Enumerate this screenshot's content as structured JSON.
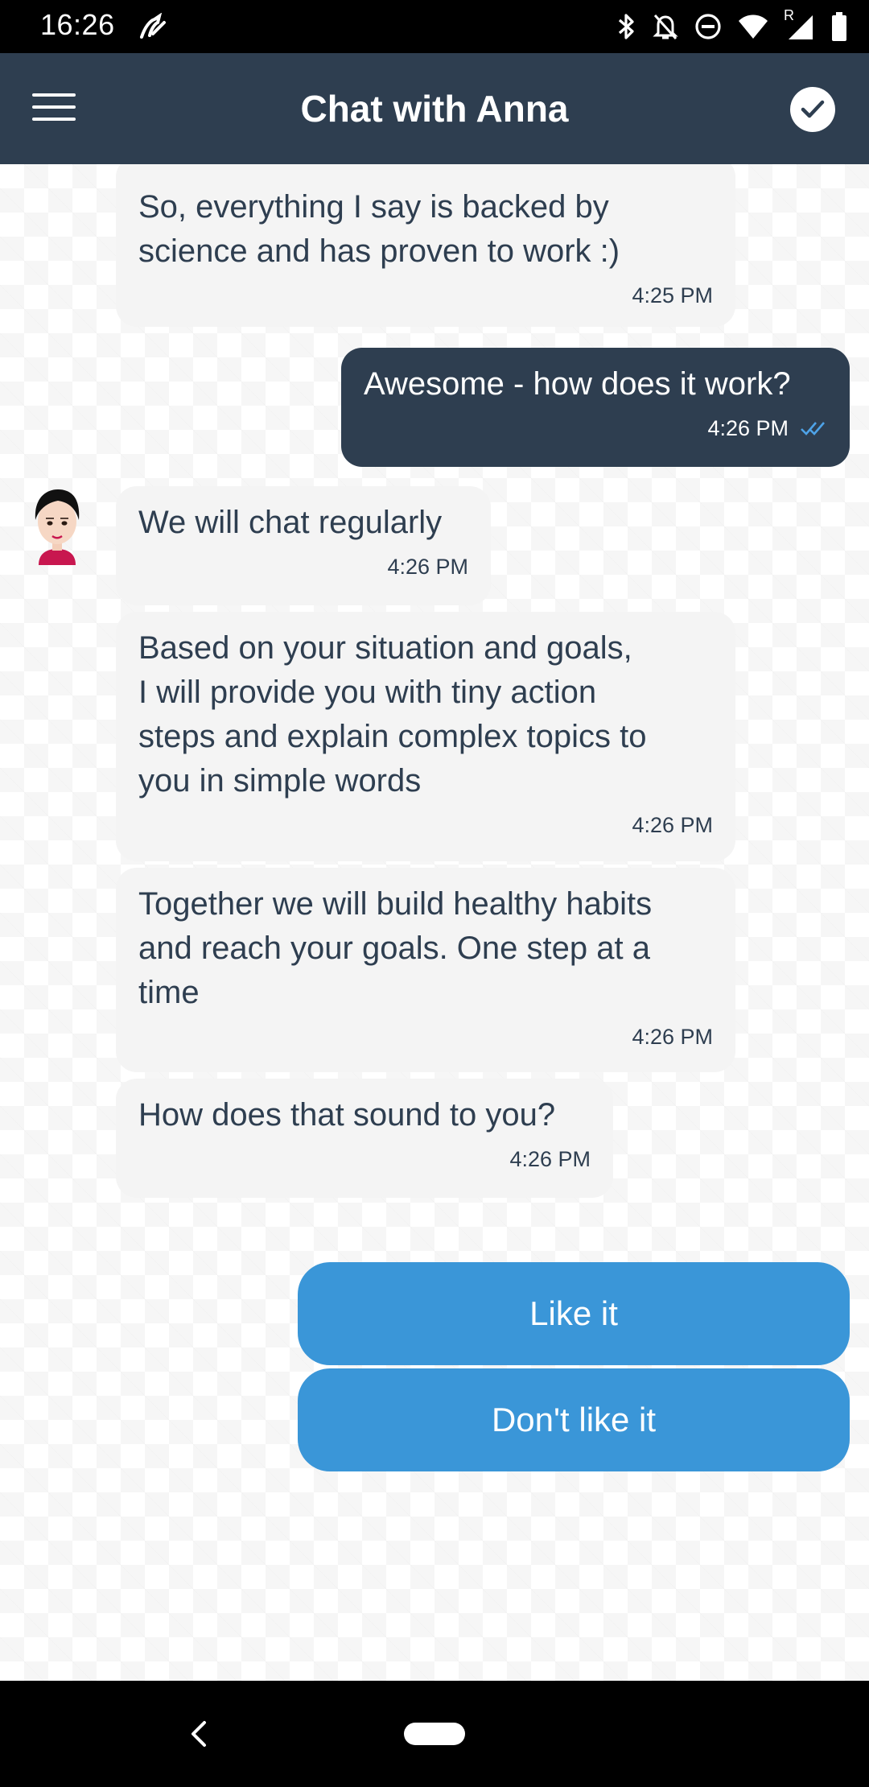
{
  "status_bar": {
    "time": "16:26",
    "icons": [
      "maps-nav-icon",
      "bluetooth-icon",
      "mute-icon",
      "dnd-icon",
      "wifi-icon",
      "signal-icon",
      "battery-icon"
    ],
    "signal_label": "R"
  },
  "app_bar": {
    "title": "Chat with Anna",
    "left_icon": "menu-icon",
    "right_icon": "check-circle-icon"
  },
  "messages": [
    {
      "sender": "Anna",
      "text": "So, everything I say is backed by\nscience and has proven to work :)",
      "time": "4:25 PM"
    },
    {
      "sender": "me",
      "text": "Awesome - how does it work?",
      "time": "4:26 PM",
      "status": "read"
    },
    {
      "sender": "Anna",
      "text": "We will chat regularly",
      "time": "4:26 PM"
    },
    {
      "sender": "Anna",
      "text": "Based on your situation and goals,\nI will provide you with tiny action\nsteps and explain complex topics to\nyou in simple words",
      "time": "4:26 PM"
    },
    {
      "sender": "Anna",
      "text": "Together we will build healthy habits\nand reach your goals. One step at a\ntime",
      "time": "4:26 PM"
    },
    {
      "sender": "Anna",
      "text": "How does that sound to you?",
      "time": "4:26 PM"
    }
  ],
  "quick_replies": [
    "Like it",
    "Don't like it"
  ],
  "colors": {
    "header": "#2e3e50",
    "bubble_incoming": "#f4f4f4",
    "bubble_outgoing": "#2e3e50",
    "reply_button": "#3a96d8",
    "read_check": "#4ea3e8"
  },
  "nav_bar": {
    "icons": [
      "back-icon",
      "home-pill-icon"
    ]
  }
}
